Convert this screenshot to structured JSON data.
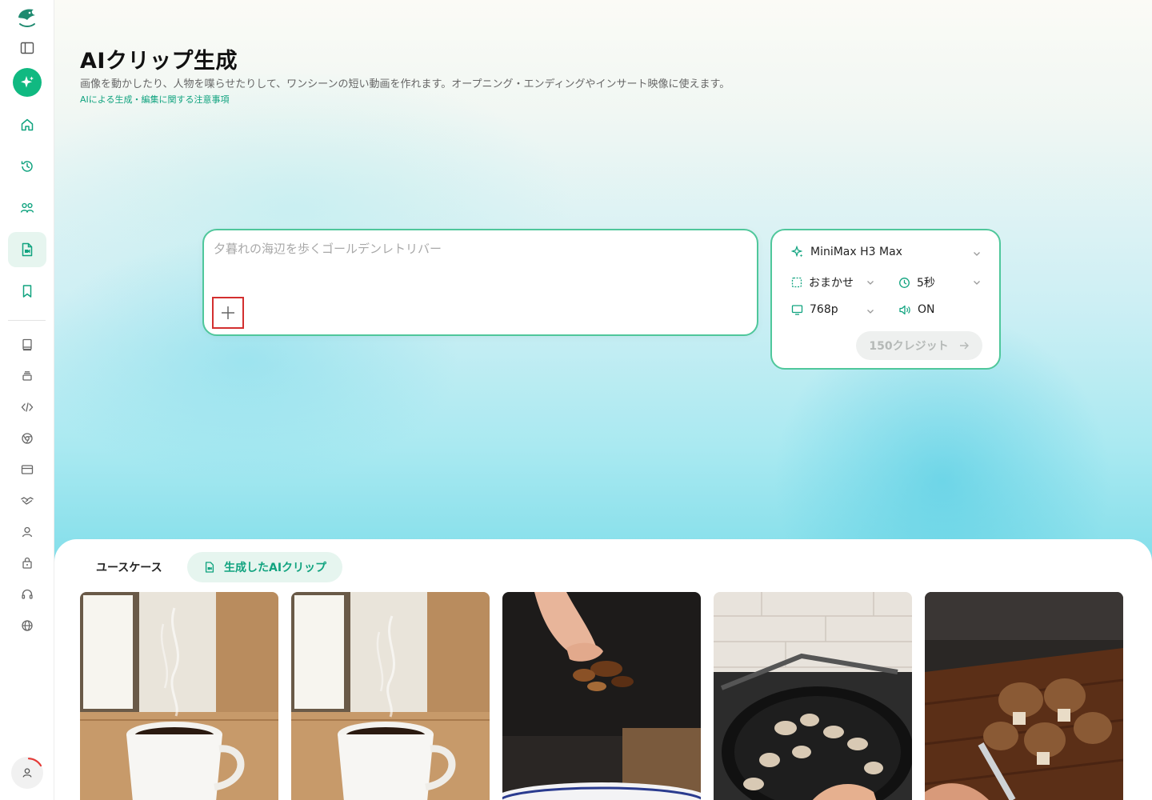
{
  "header": {
    "title": "AIクリップ生成",
    "description": "画像を動かしたり、人物を喋らせたりして、ワンシーンの短い動画を作れます。オープニング・エンディングやインサート映像に使えます。",
    "notice_link": "AIによる生成・編集に関する注意事項"
  },
  "prompt": {
    "placeholder": "夕暮れの海辺を歩くゴールデンレトリバー",
    "value": ""
  },
  "settings": {
    "model": "MiniMax H3 Max",
    "aspect": "おまかせ",
    "duration": "5秒",
    "resolution": "768p",
    "audio": "ON",
    "submit_label": "150クレジット"
  },
  "tabs": [
    {
      "label": "ユースケース",
      "active": false
    },
    {
      "label": "生成したAIクリップ",
      "active": true
    }
  ],
  "colors": {
    "accent": "#10b981",
    "accent_text": "#10a37f",
    "border": "#4fc79b",
    "highlight": "#d32f2f"
  },
  "icons": {
    "sidebar": [
      "logo-icon",
      "sidebar-toggle-icon",
      "ai-sparkle-icon",
      "home-icon",
      "history-icon",
      "team-icon",
      "clip-file-icon",
      "bookmark-icon",
      "book-icon",
      "stack-icon",
      "code-icon",
      "chrome-icon",
      "credit-card-icon",
      "handshake-icon",
      "user-icon",
      "lock-bag-icon",
      "headset-icon",
      "globe-icon"
    ]
  }
}
